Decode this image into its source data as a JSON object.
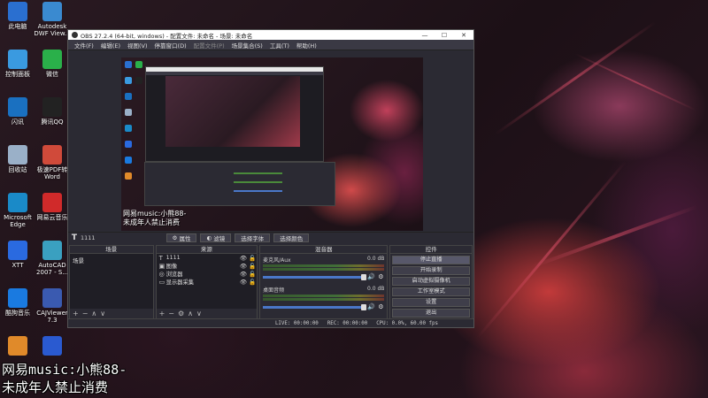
{
  "obs": {
    "title": "OBS 27.2.4 (64-bit, windows) - 配置文件: 未命名 - 场景: 未命名",
    "window_controls": [
      "—",
      "☐",
      "✕"
    ],
    "menu": [
      {
        "label": "文件(F)",
        "enabled": true
      },
      {
        "label": "编辑(E)",
        "enabled": true
      },
      {
        "label": "视图(V)",
        "enabled": true
      },
      {
        "label": "停靠窗口(D)",
        "enabled": true
      },
      {
        "label": "配置文件(P)",
        "enabled": false
      },
      {
        "label": "场景集合(S)",
        "enabled": true
      },
      {
        "label": "工具(T)",
        "enabled": true
      },
      {
        "label": "帮助(H)",
        "enabled": true
      }
    ],
    "source_toolbar": {
      "source_name": "1111",
      "properties": "属性",
      "filters": "滤镜",
      "select_font": "选择字体",
      "select_color": "选择颜色"
    },
    "scenes": {
      "title": "场景",
      "items": [
        "场景"
      ]
    },
    "sources": {
      "title": "来源",
      "items": [
        {
          "name": "1111",
          "icon": "text-icon"
        },
        {
          "name": "图像",
          "icon": "image-icon"
        },
        {
          "name": "浏览器",
          "icon": "browser-icon"
        },
        {
          "name": "显示器采集",
          "icon": "monitor-icon"
        }
      ]
    },
    "mixer": {
      "title": "混音器",
      "channels": [
        {
          "name": "麦克风/Aux",
          "db": "0.0 dB",
          "volume": 1.0
        },
        {
          "name": "桌面音频",
          "db": "0.0 dB",
          "volume": 1.0
        }
      ]
    },
    "controls": {
      "title": "控件",
      "buttons": [
        "停止直播",
        "开始录制",
        "启动虚拟摄像机",
        "工作室模式",
        "设置",
        "退出"
      ]
    },
    "status": {
      "live": "LIVE: 00:00:00",
      "rec": "REC: 00:00:00",
      "cpu": "CPU: 0.0%, 60.00 fps"
    }
  },
  "preview": {
    "overlay_lines": [
      "网易music:小熊88-",
      "未成年人禁止消费"
    ]
  },
  "desktop": {
    "icons": [
      {
        "label": "此电脑",
        "color": "#2a6fd0"
      },
      {
        "label": "Autodesk DWF View...",
        "color": "#3a8ad0"
      },
      {
        "label": "控制面板",
        "color": "#3a9ae0"
      },
      {
        "label": "微信",
        "color": "#2ab04a"
      },
      {
        "label": "闪讯",
        "color": "#1a70c0"
      },
      {
        "label": "腾讯QQ",
        "color": "#222222"
      },
      {
        "label": "回收站",
        "color": "#9ab0c8"
      },
      {
        "label": "极速PDF转Word",
        "color": "#d04a3a"
      },
      {
        "label": "Microsoft Edge",
        "color": "#1a8ac8"
      },
      {
        "label": "网易云音乐",
        "color": "#d02a2a"
      },
      {
        "label": "XTT",
        "color": "#2a6ae0"
      },
      {
        "label": "AutoCAD 2007 - S...",
        "color": "#3aa0c0"
      },
      {
        "label": "酷狗音乐",
        "color": "#1a7ae0"
      },
      {
        "label": "CAJViewer 7.3",
        "color": "#3a5ab0"
      },
      {
        "label": "",
        "color": "#e08a2a"
      },
      {
        "label": "",
        "color": "#2a5ad0"
      }
    ],
    "overlay_lines": [
      "网易music:小熊88-",
      "未成年人禁止消费"
    ]
  }
}
